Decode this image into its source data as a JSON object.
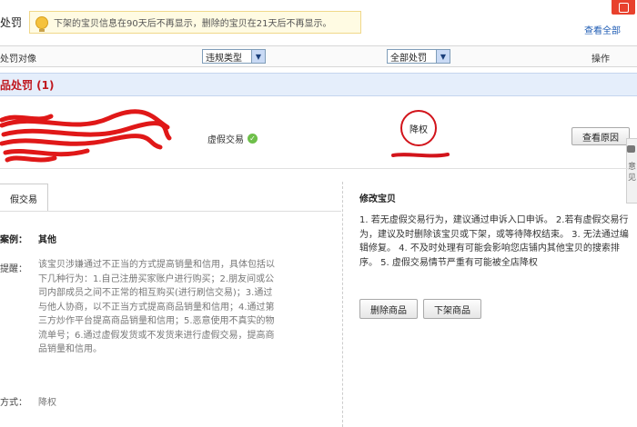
{
  "header": {
    "title": "处罚",
    "notice": "下架的宝贝信息在90天后不再显示，删除的宝贝在21天后不再显示。",
    "link": "查看全部"
  },
  "filters": {
    "object_label": "处罚对像",
    "violation_type": "违规类型",
    "all_penalties": "全部处罚",
    "operation": "操作"
  },
  "section": {
    "title": "品处罚 (1)"
  },
  "row": {
    "violation": "虚假交易",
    "penalty": "降权",
    "view_reason": "查看原因"
  },
  "side": {
    "text": "意见"
  },
  "detail": {
    "tab": "假交易",
    "case_label": "案例：",
    "case_value": "其他",
    "remind_label": "提醒：",
    "remind_text": "该宝贝涉嫌通过不正当的方式提高销量和信用，具体包括以下几种行为：1.自己注册买家账户进行购买；2.朋友间或公司内部成员之间不正常的相互购买(进行刷信交易)；3.通过与他人协商，以不正当方式提高商品销量和信用；4.通过第三方炒作平台提高商品销量和信用；5.恶意使用不真实的物流单号；6.通过虚假发货或不发货来进行虚假交易，提高商品销量和信用。",
    "method_label": "方式：",
    "method_value": "降权"
  },
  "modify": {
    "title": "修改宝贝",
    "text": "1. 若无虚假交易行为，建议通过申诉入口申诉。 2.若有虚假交易行为，建议及时删除该宝贝或下架，或等待降权结束。 3. 无法通过编辑修复。 4. 不及时处理有可能会影响您店铺内其他宝贝的搜索排序。 5. 虚假交易情节严重有可能被全店降权",
    "delete_button": "删除商品",
    "offshelf_button": "下架商品"
  },
  "colors": {
    "accent_red": "#d2141b",
    "link_blue": "#1f5cb4",
    "band_blue": "#e5eefb"
  }
}
